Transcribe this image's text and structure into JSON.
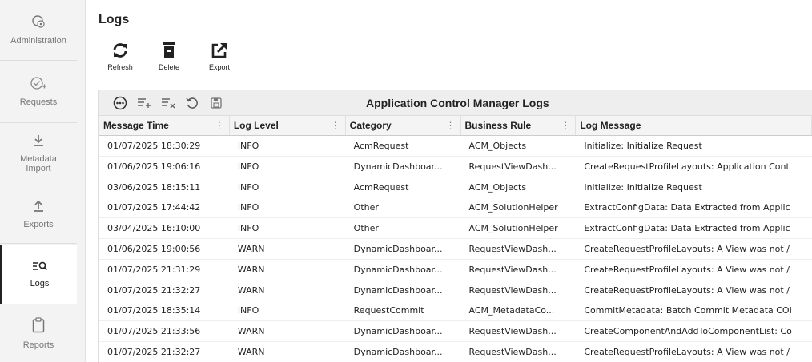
{
  "sidebar": {
    "items": [
      {
        "label": "Administration",
        "icon": "admin-gear-icon"
      },
      {
        "label": "Requests",
        "icon": "check-plus-icon"
      },
      {
        "label": "Metadata\nImport",
        "icon": "download-icon"
      },
      {
        "label": "Exports",
        "icon": "upload-icon"
      },
      {
        "label": "Logs",
        "icon": "log-search-icon",
        "active": true
      },
      {
        "label": "Reports",
        "icon": "clipboard-icon"
      }
    ]
  },
  "page": {
    "title": "Logs"
  },
  "toolbar": {
    "refresh_label": "Refresh",
    "delete_label": "Delete",
    "export_label": "Export"
  },
  "grid": {
    "title": "Application Control Manager Logs",
    "columns": [
      "Message Time",
      "Log Level",
      "Category",
      "Business Rule",
      "Log Message"
    ],
    "rows": [
      [
        "01/07/2025 18:30:29",
        "INFO",
        "AcmRequest",
        "ACM_Objects",
        "Initialize: Initialize Request"
      ],
      [
        "01/06/2025 19:06:16",
        "INFO",
        "DynamicDashboar...",
        "RequestViewDash...",
        "CreateRequestProfileLayouts: Application Cont"
      ],
      [
        "03/06/2025 18:15:11",
        "INFO",
        "AcmRequest",
        "ACM_Objects",
        "Initialize: Initialize Request"
      ],
      [
        "01/07/2025 17:44:42",
        "INFO",
        "Other",
        "ACM_SolutionHelper",
        "ExtractConfigData: Data Extracted from Applic"
      ],
      [
        "03/04/2025 16:10:00",
        "INFO",
        "Other",
        "ACM_SolutionHelper",
        "ExtractConfigData: Data Extracted from Applic"
      ],
      [
        "01/06/2025 19:00:56",
        "WARN",
        "DynamicDashboar...",
        "RequestViewDash...",
        "CreateRequestProfileLayouts: A View was not /"
      ],
      [
        "01/07/2025 21:31:29",
        "WARN",
        "DynamicDashboar...",
        "RequestViewDash...",
        "CreateRequestProfileLayouts: A View was not /"
      ],
      [
        "01/07/2025 21:32:27",
        "WARN",
        "DynamicDashboar...",
        "RequestViewDash...",
        "CreateRequestProfileLayouts: A View was not /"
      ],
      [
        "01/07/2025 18:35:14",
        "INFO",
        "RequestCommit",
        "ACM_MetadataCo...",
        "CommitMetadata: Batch Commit Metadata COI"
      ],
      [
        "01/07/2025 21:33:56",
        "WARN",
        "DynamicDashboar...",
        "RequestViewDash...",
        "CreateComponentAndAddToComponentList: Co"
      ],
      [
        "01/07/2025 21:32:27",
        "WARN",
        "DynamicDashboar...",
        "RequestViewDash...",
        "CreateRequestProfileLayouts: A View was not /"
      ]
    ]
  }
}
